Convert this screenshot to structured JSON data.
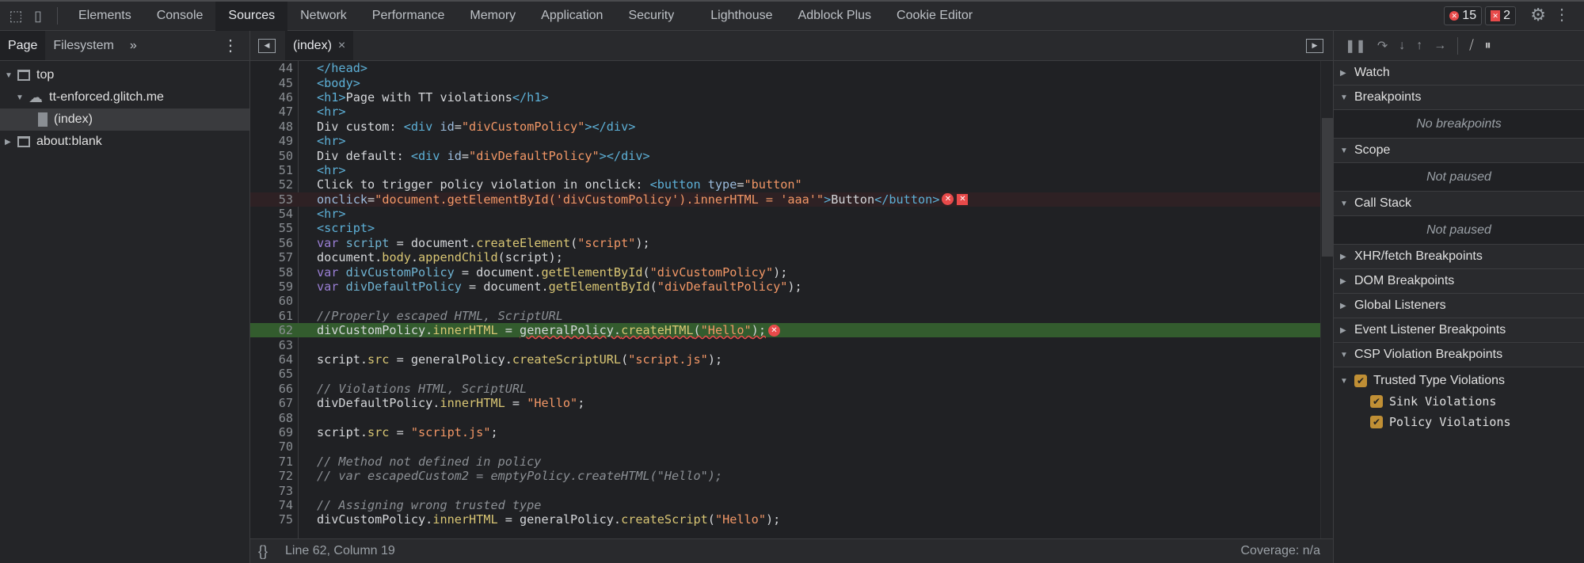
{
  "toolbar": {
    "tabs": [
      "Elements",
      "Console",
      "Sources",
      "Network",
      "Performance",
      "Memory",
      "Application",
      "Security",
      "Lighthouse",
      "Adblock Plus",
      "Cookie Editor"
    ],
    "selected": "Sources",
    "error_count": "15",
    "issue_count": "2"
  },
  "navigator": {
    "tabs": [
      "Page",
      "Filesystem"
    ],
    "more": "»",
    "tree": [
      {
        "label": "top",
        "icon": "frame-icon",
        "level": 0,
        "expanded": true
      },
      {
        "label": "tt-enforced.glitch.me",
        "icon": "cloud-icon",
        "level": 1,
        "expanded": true
      },
      {
        "label": "(index)",
        "icon": "file-icon",
        "level": 2,
        "selected": true
      },
      {
        "label": "about:blank",
        "icon": "frame-icon",
        "level": 0,
        "expanded": false
      }
    ]
  },
  "editor": {
    "tab": "(index)",
    "close": "×",
    "lines": [
      {
        "n": "44",
        "i": 0,
        "t": [
          [
            "tag",
            "</head>"
          ]
        ]
      },
      {
        "n": "45",
        "i": 0,
        "t": [
          [
            "tag",
            "<body>"
          ]
        ]
      },
      {
        "n": "46",
        "i": 2,
        "t": [
          [
            "tag",
            "<h1>"
          ],
          [
            "txt",
            "Page with TT violations"
          ],
          [
            "tag",
            "</h1>"
          ]
        ]
      },
      {
        "n": "47",
        "i": 2,
        "t": [
          [
            "tag",
            "<hr>"
          ]
        ]
      },
      {
        "n": "48",
        "i": 2,
        "t": [
          [
            "txt",
            "Div custom: "
          ],
          [
            "tag",
            "<div "
          ],
          [
            "attr",
            "id"
          ],
          [
            "txt",
            "="
          ],
          [
            "val",
            "\"divCustomPolicy\""
          ],
          [
            "tag",
            "></div>"
          ]
        ]
      },
      {
        "n": "49",
        "i": 2,
        "t": [
          [
            "tag",
            "<hr>"
          ]
        ]
      },
      {
        "n": "50",
        "i": 2,
        "t": [
          [
            "txt",
            "Div default: "
          ],
          [
            "tag",
            "<div "
          ],
          [
            "attr",
            "id"
          ],
          [
            "txt",
            "="
          ],
          [
            "val",
            "\"divDefaultPolicy\""
          ],
          [
            "tag",
            "></div>"
          ]
        ]
      },
      {
        "n": "51",
        "i": 2,
        "t": [
          [
            "tag",
            "<hr>"
          ]
        ]
      },
      {
        "n": "52",
        "i": 2,
        "t": [
          [
            "txt",
            "Click to trigger policy violation in onclick: "
          ],
          [
            "tag",
            "<button "
          ],
          [
            "attr",
            "type"
          ],
          [
            "txt",
            "="
          ],
          [
            "val",
            "\"button\""
          ]
        ]
      },
      {
        "n": "53",
        "i": 4,
        "err": true,
        "icons": [
          "error-circle-icon",
          "error-flag-icon"
        ],
        "t": [
          [
            "attr",
            "onclick"
          ],
          [
            "txt",
            "="
          ],
          [
            "val",
            "\"document.getElementById('divCustomPolicy').innerHTML = 'aaa'\""
          ],
          [
            "tag",
            ">"
          ],
          [
            "txt",
            "Button"
          ],
          [
            "tag",
            "</button>"
          ]
        ]
      },
      {
        "n": "54",
        "i": 2,
        "t": [
          [
            "tag",
            "<hr>"
          ]
        ]
      },
      {
        "n": "55",
        "i": 2,
        "t": [
          [
            "tag",
            "<script>"
          ]
        ]
      },
      {
        "n": "56",
        "i": 4,
        "t": [
          [
            "kw",
            "var "
          ],
          [
            "var",
            "script"
          ],
          [
            "txt",
            " = document."
          ],
          [
            "prop",
            "createElement"
          ],
          [
            "txt",
            "("
          ],
          [
            "str",
            "\"script\""
          ],
          [
            "txt",
            ");"
          ]
        ]
      },
      {
        "n": "57",
        "i": 4,
        "t": [
          [
            "txt",
            "document."
          ],
          [
            "prop",
            "body"
          ],
          [
            "txt",
            "."
          ],
          [
            "prop",
            "appendChild"
          ],
          [
            "txt",
            "(script);"
          ]
        ]
      },
      {
        "n": "58",
        "i": 4,
        "t": [
          [
            "kw",
            "var "
          ],
          [
            "var",
            "divCustomPolicy"
          ],
          [
            "txt",
            " = document."
          ],
          [
            "prop",
            "getElementById"
          ],
          [
            "txt",
            "("
          ],
          [
            "str",
            "\"divCustomPolicy\""
          ],
          [
            "txt",
            ");"
          ]
        ]
      },
      {
        "n": "59",
        "i": 4,
        "t": [
          [
            "kw",
            "var "
          ],
          [
            "var",
            "divDefaultPolicy"
          ],
          [
            "txt",
            " = document."
          ],
          [
            "prop",
            "getElementById"
          ],
          [
            "txt",
            "("
          ],
          [
            "str",
            "\"divDefaultPolicy\""
          ],
          [
            "txt",
            ");"
          ]
        ]
      },
      {
        "n": "60",
        "i": 0,
        "t": []
      },
      {
        "n": "61",
        "i": 4,
        "t": [
          [
            "cm",
            "//Properly escaped HTML, ScriptURL"
          ]
        ]
      },
      {
        "n": "62",
        "i": 4,
        "exec": true,
        "icons": [
          "error-circle-icon"
        ],
        "t": [
          [
            "txt",
            "divCustomPolicy."
          ],
          [
            "prop",
            "innerHTML"
          ],
          [
            "txt",
            " = "
          ],
          [
            "sq",
            "generalPolicy."
          ],
          [
            "sqp",
            "createHTML"
          ],
          [
            "sq",
            "("
          ],
          [
            "sqs",
            "\"Hello\""
          ],
          [
            "sq",
            ");"
          ]
        ]
      },
      {
        "n": "63",
        "i": 0,
        "t": []
      },
      {
        "n": "64",
        "i": 4,
        "t": [
          [
            "txt",
            "script."
          ],
          [
            "prop",
            "src"
          ],
          [
            "txt",
            " = generalPolicy."
          ],
          [
            "prop",
            "createScriptURL"
          ],
          [
            "txt",
            "("
          ],
          [
            "str",
            "\"script.js\""
          ],
          [
            "txt",
            ");"
          ]
        ]
      },
      {
        "n": "65",
        "i": 0,
        "t": []
      },
      {
        "n": "66",
        "i": 4,
        "t": [
          [
            "cm",
            "// Violations HTML, ScriptURL"
          ]
        ]
      },
      {
        "n": "67",
        "i": 4,
        "t": [
          [
            "txt",
            "divDefaultPolicy."
          ],
          [
            "prop",
            "innerHTML"
          ],
          [
            "txt",
            " = "
          ],
          [
            "str",
            "\"Hello\""
          ],
          [
            "txt",
            ";"
          ]
        ]
      },
      {
        "n": "68",
        "i": 0,
        "t": []
      },
      {
        "n": "69",
        "i": 4,
        "t": [
          [
            "txt",
            "script."
          ],
          [
            "prop",
            "src"
          ],
          [
            "txt",
            " = "
          ],
          [
            "str",
            "\"script.js\""
          ],
          [
            "txt",
            ";"
          ]
        ]
      },
      {
        "n": "70",
        "i": 0,
        "t": []
      },
      {
        "n": "71",
        "i": 4,
        "t": [
          [
            "cm",
            "// Method not defined in policy"
          ]
        ]
      },
      {
        "n": "72",
        "i": 4,
        "t": [
          [
            "cm",
            "// var escapedCustom2 = emptyPolicy.createHTML(\"Hello\");"
          ]
        ]
      },
      {
        "n": "73",
        "i": 0,
        "t": []
      },
      {
        "n": "74",
        "i": 4,
        "t": [
          [
            "cm",
            "// Assigning wrong trusted type"
          ]
        ]
      },
      {
        "n": "75",
        "i": 4,
        "t": [
          [
            "txt",
            "divCustomPolicy."
          ],
          [
            "prop",
            "innerHTML"
          ],
          [
            "txt",
            " = generalPolicy."
          ],
          [
            "prop",
            "createScript"
          ],
          [
            "txt",
            "("
          ],
          [
            "str",
            "\"Hello\""
          ],
          [
            "txt",
            ");"
          ]
        ]
      }
    ]
  },
  "status": {
    "format_icon": "{}",
    "position": "Line 62, Column 19",
    "coverage": "Coverage: n/a"
  },
  "debugger": {
    "sections": [
      {
        "label": "Watch",
        "expanded": false
      },
      {
        "label": "Breakpoints",
        "expanded": true,
        "empty": "No breakpoints"
      },
      {
        "label": "Scope",
        "expanded": true,
        "empty": "Not paused"
      },
      {
        "label": "Call Stack",
        "expanded": true,
        "empty": "Not paused"
      },
      {
        "label": "XHR/fetch Breakpoints",
        "expanded": false
      },
      {
        "label": "DOM Breakpoints",
        "expanded": false
      },
      {
        "label": "Global Listeners",
        "expanded": false
      },
      {
        "label": "Event Listener Breakpoints",
        "expanded": false
      },
      {
        "label": "CSP Violation Breakpoints",
        "expanded": true
      }
    ],
    "csp": {
      "group": "Trusted Type Violations",
      "group_checked": true,
      "items": [
        {
          "label": "Sink Violations",
          "checked": true
        },
        {
          "label": "Policy Violations",
          "checked": true
        }
      ]
    },
    "accent": "#c08f35"
  }
}
